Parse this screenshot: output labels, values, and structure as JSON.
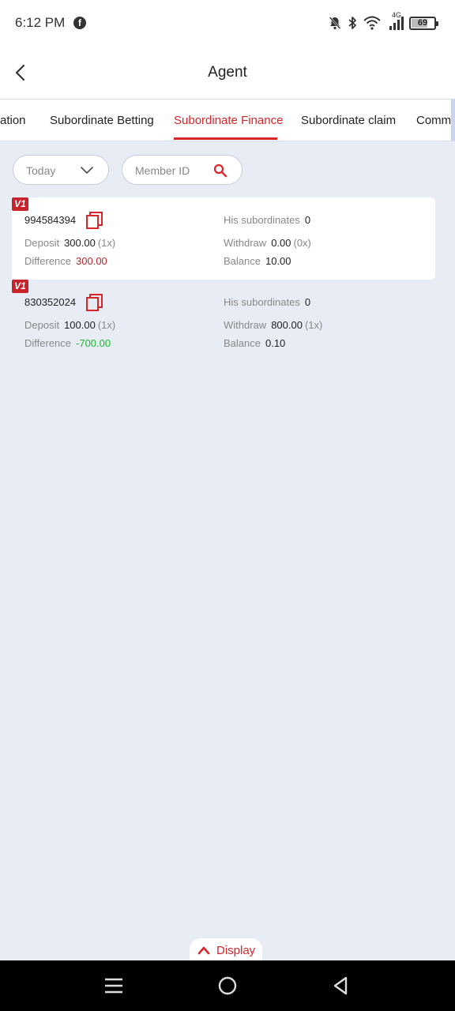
{
  "status_bar": {
    "time": "6:12 PM",
    "network_label": "4G",
    "battery_level": "69",
    "icons": [
      "facebook-icon",
      "bell-off-icon",
      "bluetooth-icon",
      "wifi-icon",
      "signal-icon",
      "battery-icon"
    ]
  },
  "header": {
    "title": "Agent",
    "back_icon": "chevron-left-icon"
  },
  "tabs": [
    {
      "label": "ation",
      "active": false
    },
    {
      "label": "Subordinate Betting",
      "active": false
    },
    {
      "label": "Subordinate Finance",
      "active": true
    },
    {
      "label": "Subordinate claim",
      "active": false
    },
    {
      "label": "Commi",
      "active": false
    }
  ],
  "filters": {
    "date_value": "Today",
    "search_placeholder": "Member ID"
  },
  "members": [
    {
      "badge": "V1",
      "id": "994584394",
      "deposit_label": "Deposit",
      "deposit": "300.00",
      "deposit_mult": "(1x)",
      "difference_label": "Difference",
      "difference": "300.00",
      "subordinates_label": "His subordinates",
      "subordinates": "0",
      "withdraw_label": "Withdraw",
      "withdraw": "0.00",
      "withdraw_mult": "(0x)",
      "balance_label": "Balance",
      "balance": "10.00"
    },
    {
      "badge": "V1",
      "id": "830352024",
      "deposit_label": "Deposit",
      "deposit": "100.00",
      "deposit_mult": "(1x)",
      "difference_label": "Difference",
      "difference": "-700.00",
      "subordinates_label": "His subordinates",
      "subordinates": "0",
      "withdraw_label": "Withdraw",
      "withdraw": "800.00",
      "withdraw_mult": "(1x)",
      "balance_label": "Balance",
      "balance": "0.10"
    }
  ],
  "display_button": {
    "label": "Display"
  },
  "colors": {
    "accent": "#d9262a",
    "positive_difference": "#c0282d",
    "negative_difference": "#18b82a",
    "background": "#e8ecf4"
  }
}
